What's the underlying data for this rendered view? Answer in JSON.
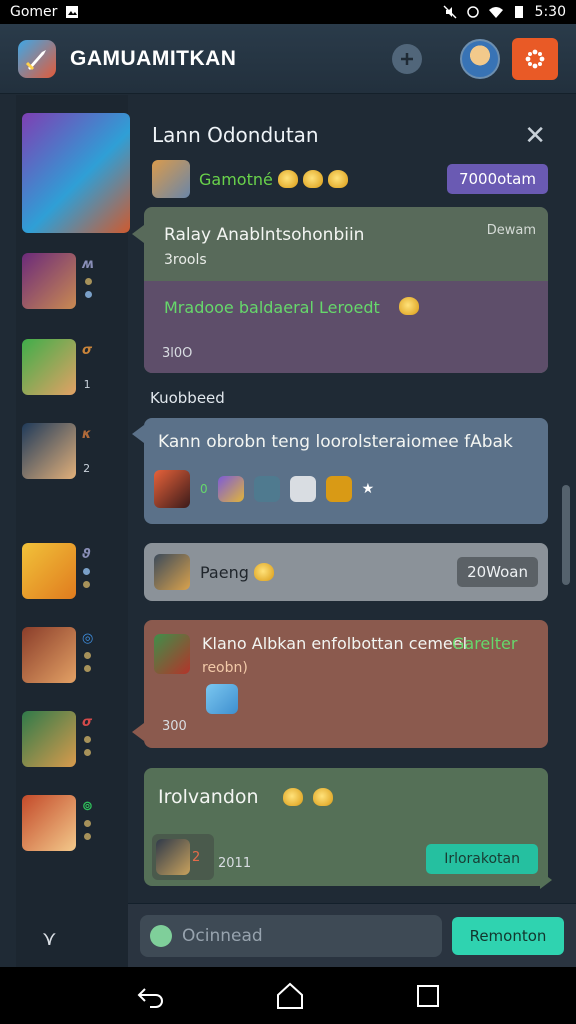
{
  "status_bar": {
    "carrier": "Gomer",
    "time": "5:30"
  },
  "app_bar": {
    "title": "GAMUAMITKAN"
  },
  "chat": {
    "header": "Lann Odondutan",
    "sub_name": "Gamotné",
    "sub_pill": "7000otam"
  },
  "messages": {
    "m1": {
      "title": "Ralay Anablntsohonbiin",
      "tag": "Dewam",
      "sub": "3rools",
      "highlight": "Mradooe baldaeral Leroedt",
      "number": "3l0O"
    },
    "section_label": "Kuobbeed",
    "m2": {
      "title": "Kann obrobn teng loorolsteraiomee fAbak"
    },
    "m3": {
      "name": "Paeng",
      "pill": "20Woan"
    },
    "m4": {
      "title": "Klano Albkan enfolbottan cemeel",
      "highlight": "Garelter",
      "sub": "reobn)",
      "number": "300"
    },
    "m5": {
      "title": "Irolvandon",
      "number": "2011",
      "button": "Irlorakotan"
    }
  },
  "input_bar": {
    "placeholder": "Ocinnead",
    "send_label": "Remonton"
  },
  "colors": {
    "accent_orange": "#e95a26",
    "accent_teal": "#2fd3b0",
    "accent_purple": "#6a5ab3",
    "highlight_green": "#66d86b"
  }
}
